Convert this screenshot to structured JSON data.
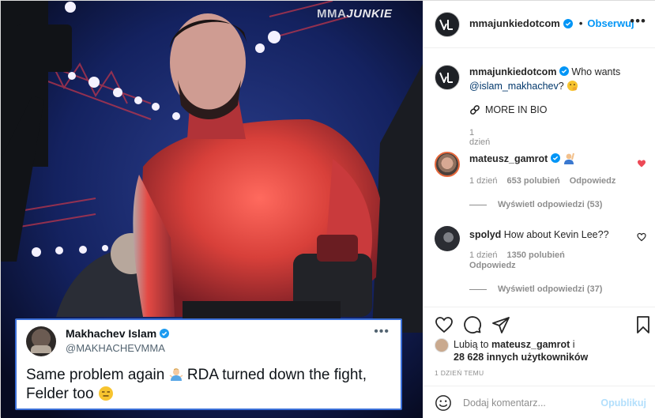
{
  "media": {
    "watermark_a": "MMA",
    "watermark_b": "JUNKIE",
    "tweet": {
      "name": "Makhachev Islam",
      "handle": "@MAKHACHEVMMA",
      "text_1": "Same problem again",
      "text_2": "RDA turned down the fight,",
      "text_3": "Felder too",
      "more": "•••"
    }
  },
  "header": {
    "username": "mmajunkiedotcom",
    "separator": "•",
    "follow_label": "Obserwuj",
    "more": "•••"
  },
  "caption": {
    "username": "mmajunkiedotcom",
    "text_pre": "Who wants",
    "mention": "@islam_makhachev",
    "text_post": "?",
    "bio_line": "MORE IN BIO",
    "time": "1 dzień"
  },
  "comments": [
    {
      "username": "mateusz_gamrot",
      "time": "1 dzień",
      "likes": "653 polubień",
      "reply_label": "Odpowiedz",
      "view_replies": "Wyświetl odpowiedzi (53)",
      "liked": true
    },
    {
      "username": "spolyd",
      "text": "How about Kevin Lee??",
      "time": "1 dzień",
      "likes": "1350 polubień",
      "reply_label": "Odpowiedz",
      "view_replies": "Wyświetl odpowiedzi (37)",
      "liked": false
    }
  ],
  "likes_summary": {
    "prefix": "Lubią to",
    "user": "mateusz_gamrot",
    "middle": "i",
    "count": "28 628 innych użytkowników"
  },
  "post_time": "1 DZIEŃ TEMU",
  "comment_box": {
    "placeholder": "Dodaj komentarz...",
    "publish_label": "Opublikuj"
  },
  "colors": {
    "accent": "#0095f6",
    "heart": "#ed4956",
    "mention": "#00376b",
    "publish_disabled": "#b2dffc"
  }
}
